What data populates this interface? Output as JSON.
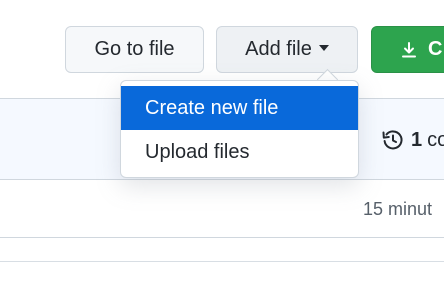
{
  "toolbar": {
    "go_to_file_label": "Go to file",
    "add_file_label": "Add file",
    "code_label": "C"
  },
  "repo": {
    "commit_count": "1",
    "commit_label_partial": "co",
    "last_update": "15 minut"
  },
  "add_file_menu": {
    "items": [
      {
        "label": "Create new file",
        "active": true
      },
      {
        "label": "Upload files",
        "active": false
      }
    ]
  },
  "colors": {
    "accent_blue": "#0969da",
    "code_green": "#2da44e"
  },
  "icons": {
    "download": "download-icon",
    "history": "history-icon",
    "caret": "caret-down-icon"
  }
}
